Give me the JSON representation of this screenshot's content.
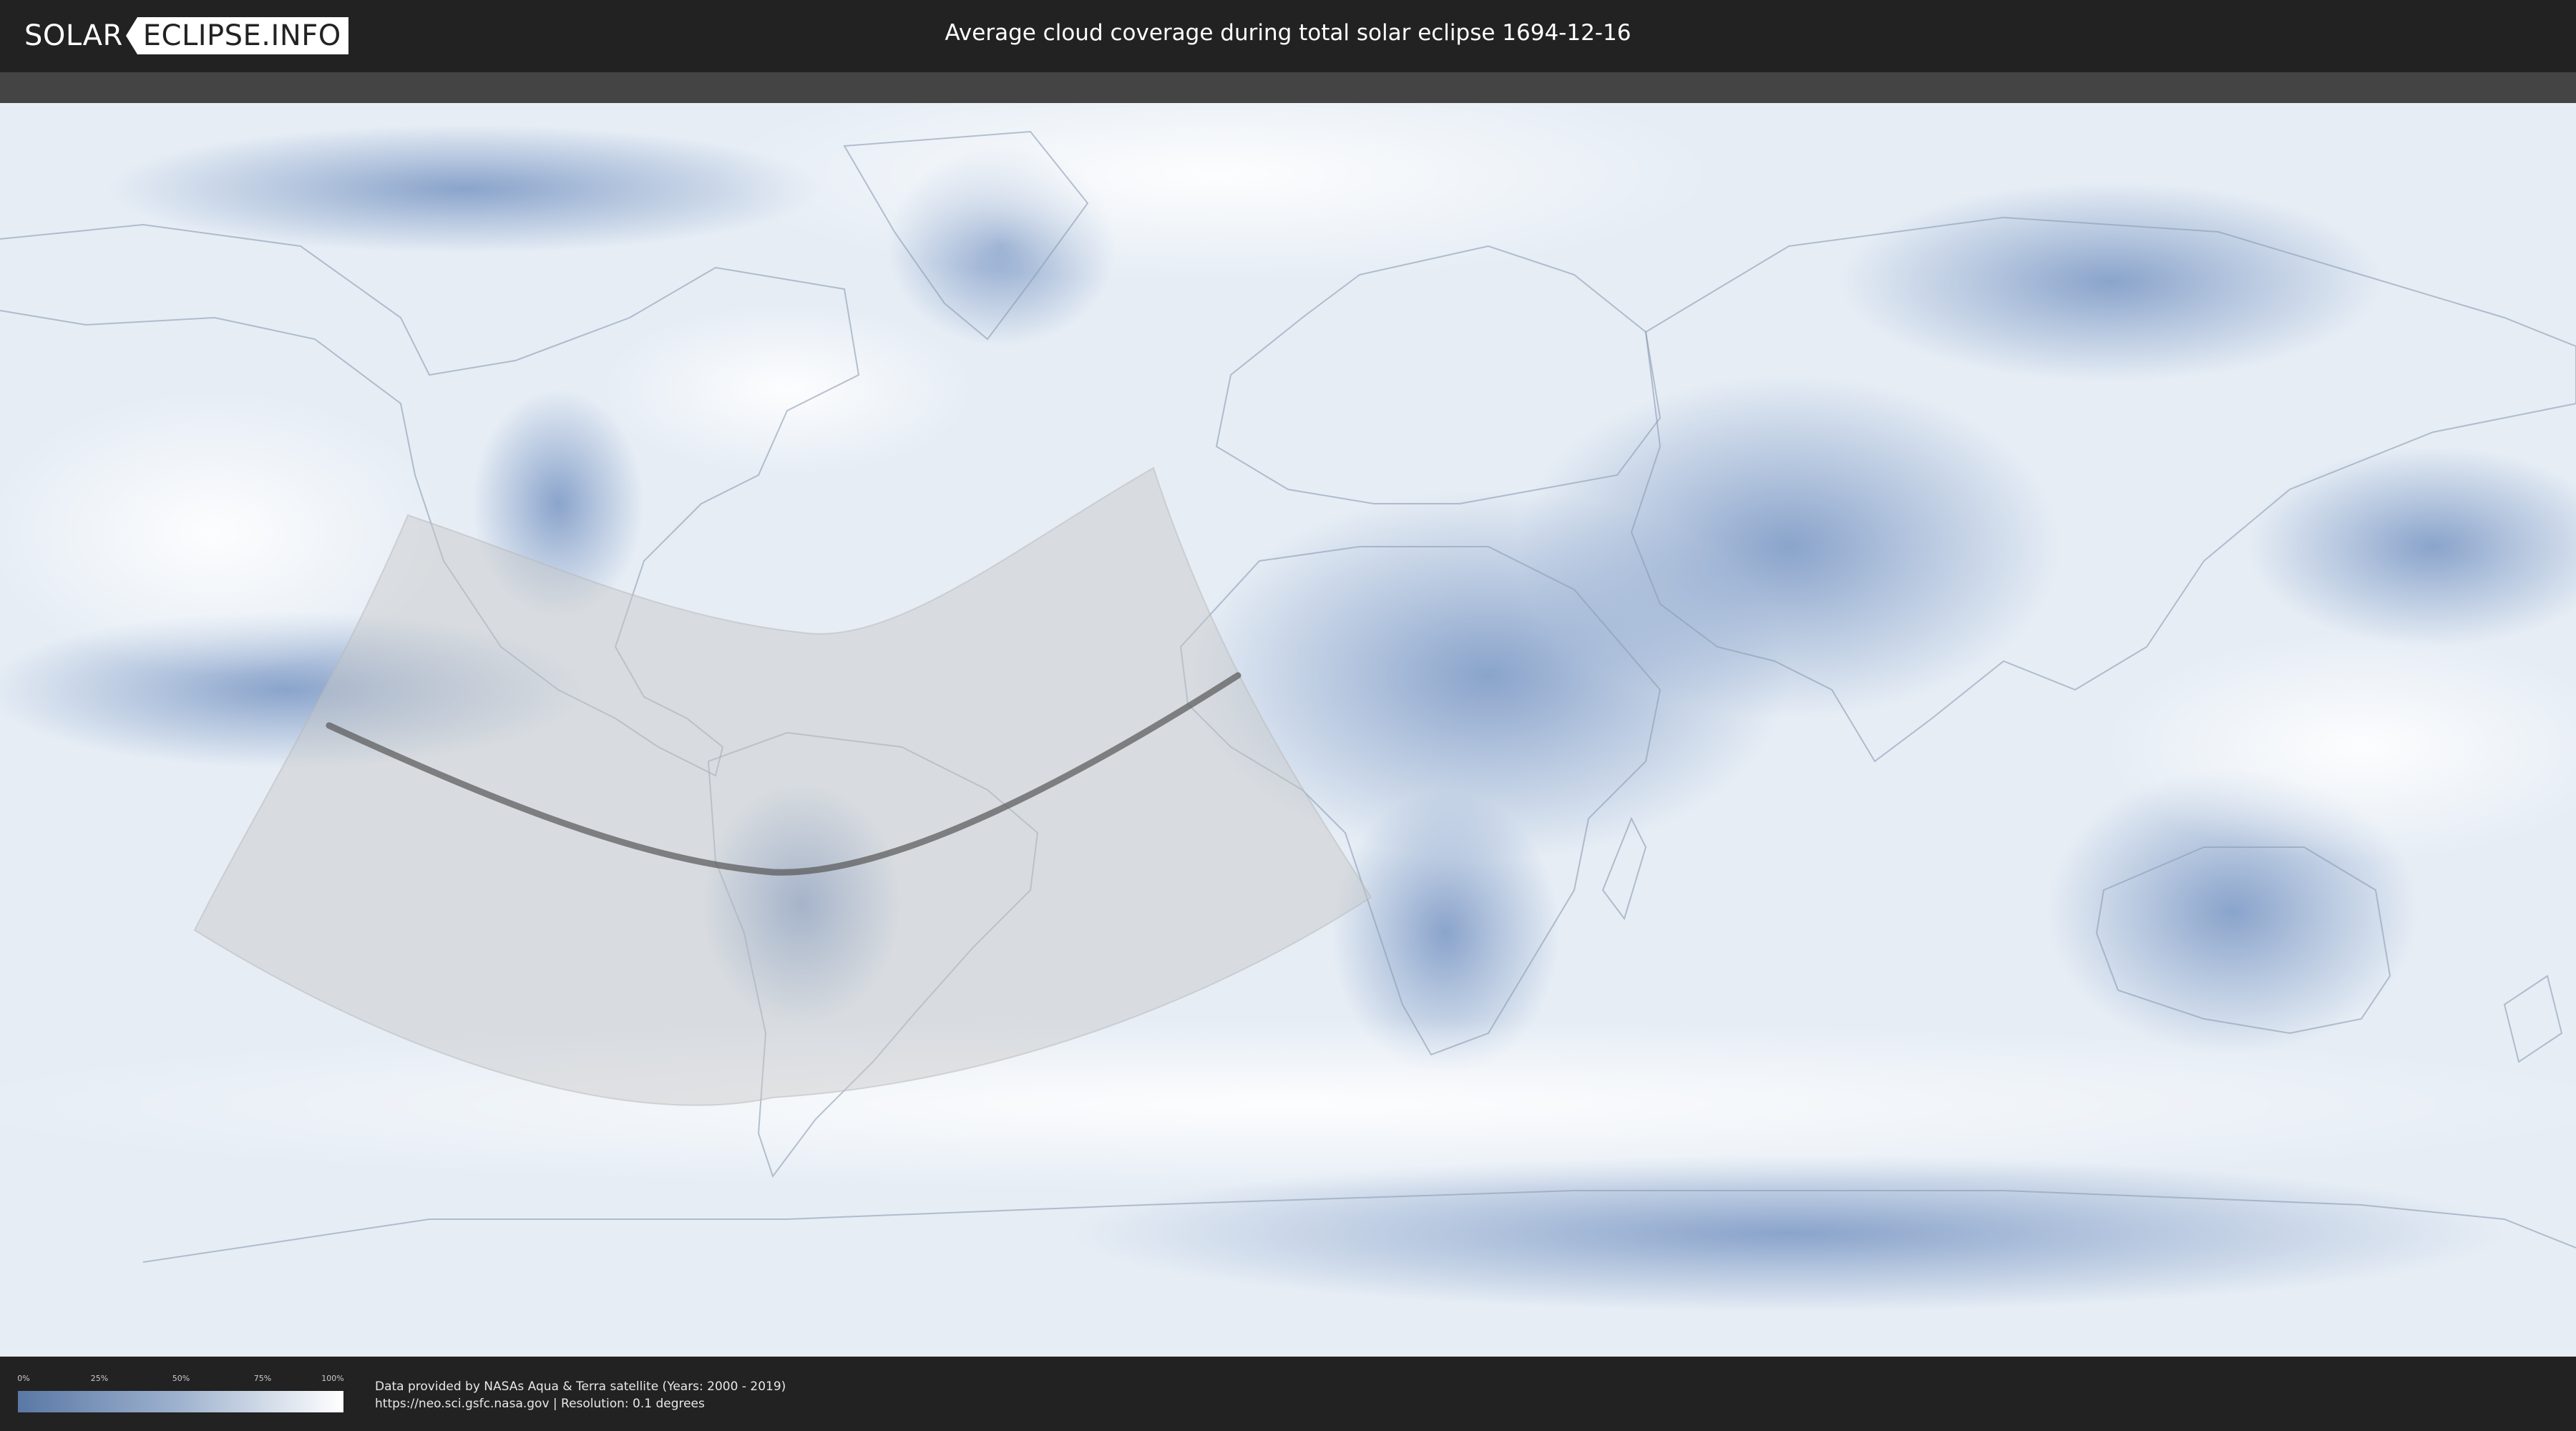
{
  "header": {
    "logo_part1": "SOLAR",
    "logo_part2": "ECLIPSE.INFO",
    "title": "Average cloud coverage during total solar eclipse 1694-12-16"
  },
  "legend": {
    "ticks": [
      "0%",
      "25%",
      "50%",
      "75%",
      "100%"
    ],
    "colors": {
      "low": "#5a78a5",
      "mid": "#9fb3cf",
      "high": "#ffffff"
    }
  },
  "credits": {
    "line1": "Data provided by NASAs Aqua & Terra satellite (Years: 2000 - 2019)",
    "line2": "https://neo.sci.gsfc.nasa.gov | Resolution: 0.1 degrees"
  },
  "map": {
    "projection": "equirectangular",
    "colors": {
      "ocean_clear": "#eef3f8",
      "cloud_low": "#6b8bbd",
      "land_outline": "#8a9bb3",
      "shadow": "#c8c8c8",
      "central_line": "#555555"
    }
  }
}
